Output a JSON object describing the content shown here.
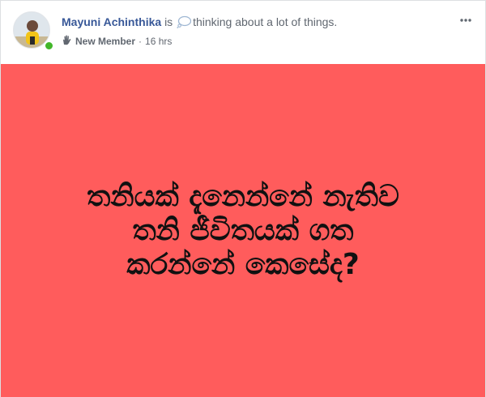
{
  "post": {
    "author": "Mayuni Achinthika",
    "activity_connector": "is",
    "activity_icon": "thought-bubble-icon",
    "activity_text": "thinking about a lot of things.",
    "badge_icon": "waving-hand-icon",
    "badge": "New Member",
    "separator": "·",
    "timestamp": "16 hrs",
    "status_text": "තනියක් දැනෙන්නේ නැතිව\nතනි ජීවිතයක් ගත\nකරන්නේ කෙසේද?",
    "background_color": "#ff5c5c",
    "author_color": "#385898",
    "online_color": "#42b72a"
  }
}
